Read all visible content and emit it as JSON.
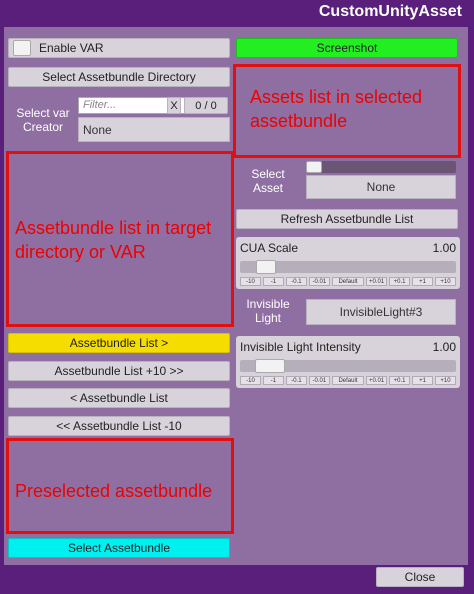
{
  "window": {
    "title": "CustomUnityAsset"
  },
  "left": {
    "enable_var_label": "Enable VAR",
    "select_dir_label": "Select Assetbundle Directory",
    "select_var_creator_label": "Select var Creator",
    "filter_placeholder": "Filter...",
    "filter_clear": "X",
    "filter_count": "0 / 0",
    "creator_value": "None",
    "assetbundle_list_note": "Assetbundle list in target directory or VAR",
    "nav": {
      "next": "Assetbundle List >",
      "next10": "Assetbundle List +10 >>",
      "prev": "< Assetbundle List",
      "prev10": "<< Assetbundle List -10"
    },
    "preselected_note": "Preselected assetbundle",
    "select_assetbundle_label": "Select Assetbundle"
  },
  "right": {
    "screenshot_label": "Screenshot",
    "assets_list_note": "Assets list in selected assetbundle",
    "select_asset_label": "Select Asset",
    "select_asset_value": "None",
    "refresh_label": "Refresh Assetbundle List",
    "scale": {
      "label": "CUA Scale",
      "value": "1.00",
      "level": 0.08
    },
    "invisible_light_label": "Invisible Light",
    "invisible_light_value": "InvisibleLight#3",
    "intensity": {
      "label": "Invisible Light Intensity",
      "value": "1.00",
      "level": 0.08
    },
    "step_buttons": [
      "-10",
      "-1",
      "-0.1",
      "-0.01",
      "Default",
      "+0.01",
      "+0.1",
      "+1",
      "+10"
    ]
  },
  "footer": {
    "close_label": "Close"
  },
  "colors": {
    "frame": "#5a1f7a",
    "panel": "#8f6fa2",
    "screenshot": "#22ee22",
    "nav_next": "#f5dd00",
    "select_assetbundle": "#00f0f0",
    "highlight": "#e01010"
  }
}
